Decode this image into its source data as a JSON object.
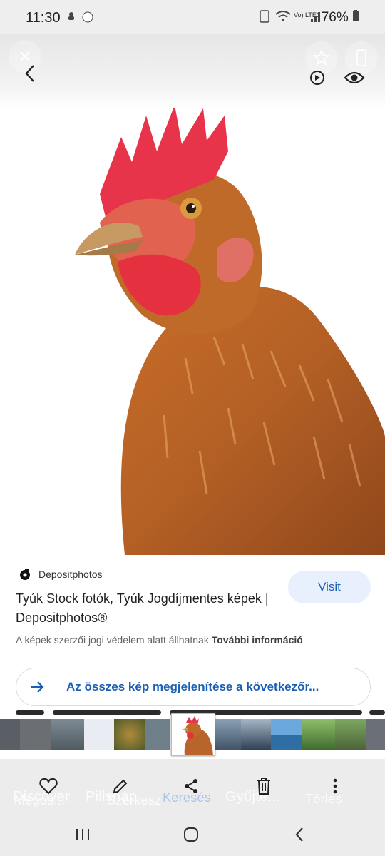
{
  "status_bar": {
    "time": "11:30",
    "network": "Vo) LTE1",
    "battery": "76%"
  },
  "card": {
    "source_name": "Depositphotos",
    "title": "Tyúk Stock fotók, Tyúk Jogdíjmentes képek | Depositphotos®",
    "visit_label": "Visit",
    "copyright_text": "A képek szerzői jogi védelem alatt állhatnak",
    "more_info_label": "További információ",
    "see_all_label": "Az összes kép megjelenítése a következőr..."
  },
  "bottom_ghost_labels": {
    "share": "Megos...",
    "discover": "Discover",
    "pillsnap": "Pillsnap",
    "edit": "Szerkesz",
    "search": "Keresés",
    "collect": "Gyűjte...",
    "delete": "Törlés"
  },
  "colors": {
    "accent": "#1a5fb4",
    "visit_bg": "#e8f0fe",
    "bar_bg": "#ececec"
  }
}
